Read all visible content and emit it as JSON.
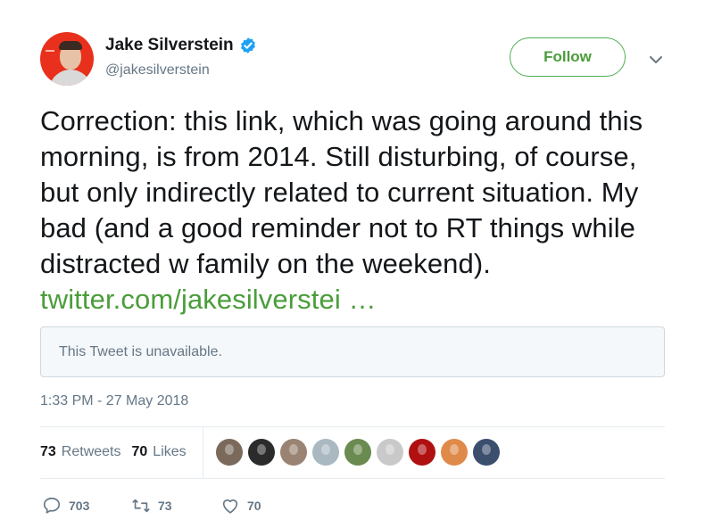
{
  "author": {
    "name": "Jake Silverstein",
    "handle": "@jakesilverstein",
    "verified": true
  },
  "follow_label": "Follow",
  "tweet": {
    "text": "Correction: this link, which was going around this morning, is from 2014. Still disturbing, of course, but only indirectly related to current situation. My bad (and a good reminder not to RT things while distracted w family on the weekend). ",
    "link": "twitter.com/jakesilverstei …",
    "quoted_unavailable": "This Tweet is unavailable.",
    "timestamp": "1:33 PM - 27 May 2018"
  },
  "stats": {
    "retweets_count": "73",
    "retweets_label": "Retweets",
    "likes_count": "70",
    "likes_label": "Likes"
  },
  "actions": {
    "replies": "703",
    "retweets": "73",
    "likes": "70"
  },
  "icons": {
    "verified": "verified-badge-icon",
    "caret": "chevron-down-icon",
    "reply": "reply-icon",
    "retweet": "retweet-icon",
    "like": "heart-icon"
  },
  "colors": {
    "accent": "#4a9d3a",
    "verified": "#1da1f2",
    "text": "#14171a",
    "muted": "#657786"
  },
  "likers": [
    {
      "name": "liker-avatar-1",
      "bg": "#7b6a5c"
    },
    {
      "name": "liker-avatar-2",
      "bg": "#2b2b2b"
    },
    {
      "name": "liker-avatar-3",
      "bg": "#9a8372"
    },
    {
      "name": "liker-avatar-4",
      "bg": "#aab8c2"
    },
    {
      "name": "liker-avatar-5",
      "bg": "#6a8a4f"
    },
    {
      "name": "liker-avatar-6",
      "bg": "#c9c9c9"
    },
    {
      "name": "liker-avatar-7",
      "bg": "#b01010"
    },
    {
      "name": "liker-avatar-8",
      "bg": "#e08a4a"
    },
    {
      "name": "liker-avatar-9",
      "bg": "#3c4e6e"
    }
  ]
}
